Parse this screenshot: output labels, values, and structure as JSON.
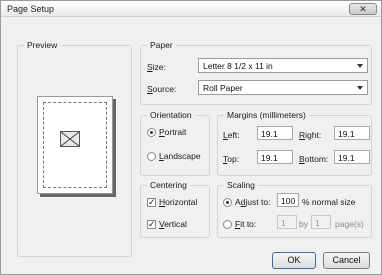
{
  "window": {
    "title": "Page Setup",
    "close_glyph": "✕"
  },
  "preview": {
    "title": "Preview"
  },
  "paper": {
    "title": "Paper",
    "size_label": "Size:",
    "size_value": "Letter 8 1/2 x 11 in",
    "source_label": "Source:",
    "source_value": "Roll Paper"
  },
  "orientation": {
    "title": "Orientation",
    "portrait_label": "Portrait",
    "landscape_label": "Landscape",
    "selected": "Portrait"
  },
  "margins": {
    "title": "Margins (millimeters)",
    "left_label": "Left:",
    "left_value": "19.1",
    "right_label": "Right:",
    "right_value": "19.1",
    "top_label": "Top:",
    "top_value": "19.1",
    "bottom_label": "Bottom:",
    "bottom_value": "19.1"
  },
  "centering": {
    "title": "Centering",
    "horizontal_label": "Horizontal",
    "horizontal_checked": true,
    "vertical_label": "Vertical",
    "vertical_checked": true
  },
  "scaling": {
    "title": "Scaling",
    "adjust_label": "Adjust to:",
    "adjust_value": "100",
    "adjust_suffix": "% normal size",
    "fit_label": "Fit to:",
    "fit_value_1": "1",
    "fit_by": "by",
    "fit_value_2": "1",
    "fit_suffix": "page(s)",
    "selected": "Adjust to"
  },
  "buttons": {
    "ok": "OK",
    "cancel": "Cancel"
  },
  "check_glyph": "✓"
}
